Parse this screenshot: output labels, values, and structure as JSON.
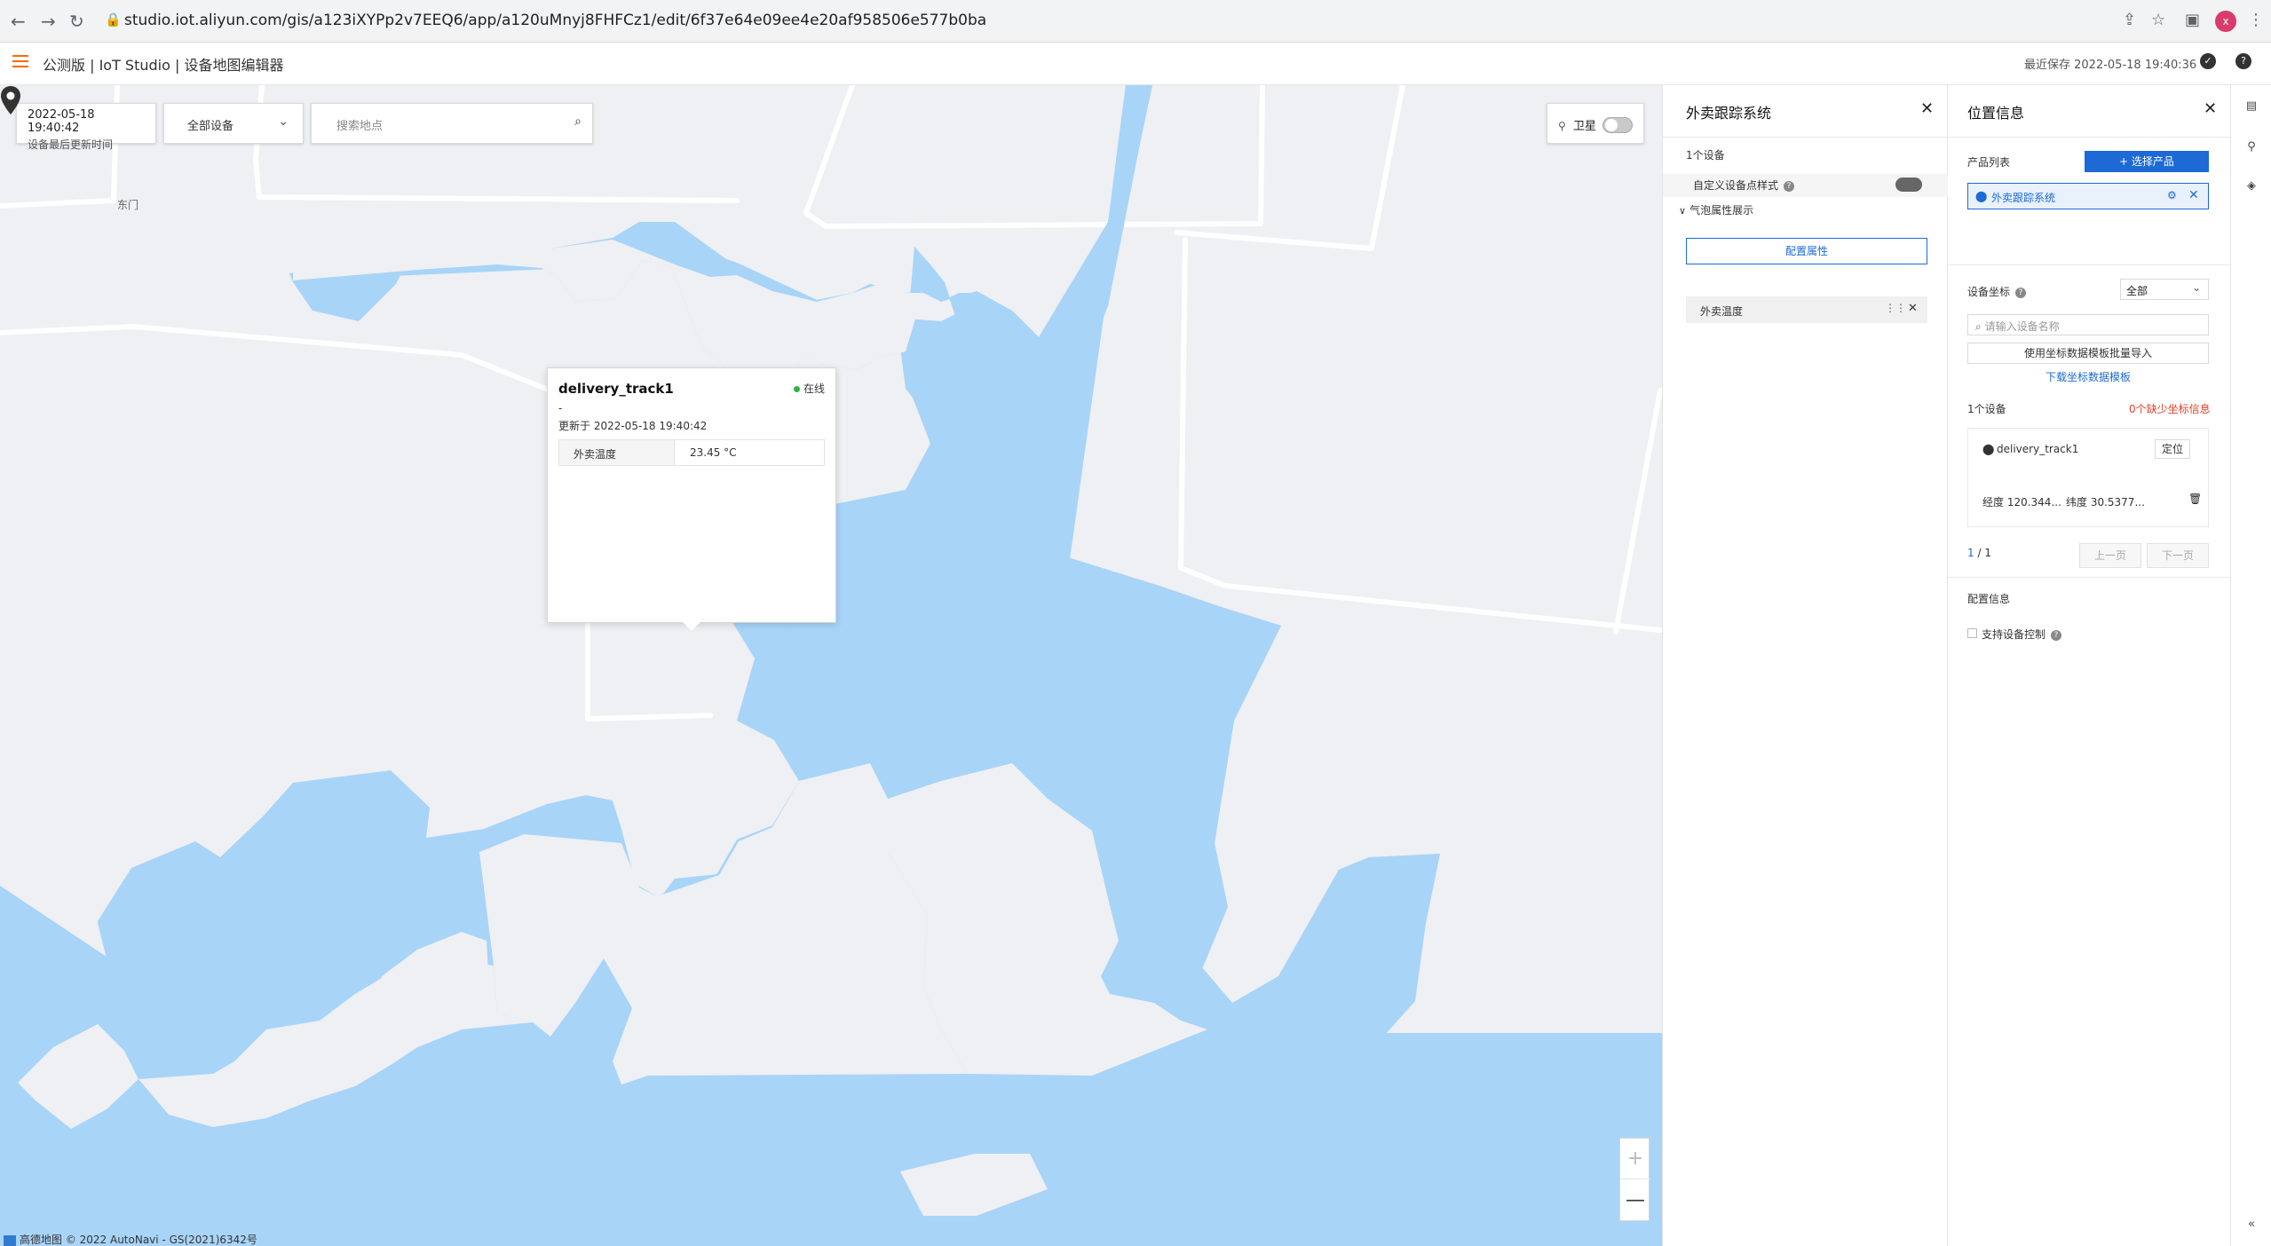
{
  "browser": {
    "url": "studio.iot.aliyun.com/gis/a123iXYPp2v7EEQ6/app/a120uMnyj8FHFCz1/edit/6f37e64e09ee4e20af958506e577b0ba",
    "avatar": "x"
  },
  "header": {
    "title": "公测版 | IoT Studio | 设备地图编辑器",
    "save_time": "最近保存 2022-05-18 19:40:36"
  },
  "map": {
    "time_value": "2022-05-18 19:40:42",
    "time_caption": "设备最后更新时间",
    "device_filter": "全部设备",
    "search_placeholder": "搜索地点",
    "satellite_label": "卫星",
    "place_label": "东门",
    "zoom_in": "+",
    "zoom_out": "—",
    "copyright": "高德地图 © 2022 AutoNavi - GS(2021)6342号",
    "colors": {
      "water": "#a8d4f8",
      "land": "#eef0f3",
      "road": "#ffffff"
    }
  },
  "popup": {
    "device_name": "delivery_track1",
    "status": "在线",
    "description": "-",
    "updated": "更新于 2022-05-18 19:40:42",
    "property_key": "外卖温度",
    "property_value": "23.45 °C"
  },
  "product_panel": {
    "title": "外卖跟踪系统",
    "device_count": "1个设备",
    "custom_style_label": "自定义设备点样式",
    "bubble_section": "气泡属性展示",
    "config_button": "配置属性",
    "attribute_item": "外卖温度"
  },
  "location_panel": {
    "title": "位置信息",
    "product_list_label": "产品列表",
    "select_product_button": "+ 选择产品",
    "selected_product": "外卖跟踪系统",
    "device_coords_label": "设备坐标",
    "coords_filter": "全部",
    "device_search_placeholder": "请输入设备名称",
    "batch_import_button": "使用坐标数据模板批量导入",
    "download_template_link": "下载坐标数据模板",
    "device_count": "1个设备",
    "missing_coords": "0个缺少坐标信息",
    "device_name": "delivery_track1",
    "locate_button": "定位",
    "longitude": "经度 120.344...",
    "latitude": "纬度 30.5377...",
    "page_current": "1",
    "page_total": " / 1",
    "prev_button": "上一页",
    "next_button": "下一页",
    "config_info_label": "配置信息",
    "device_control_label": "支持设备控制",
    "accent": "#1d6ad6",
    "warning": "#e2402b"
  }
}
